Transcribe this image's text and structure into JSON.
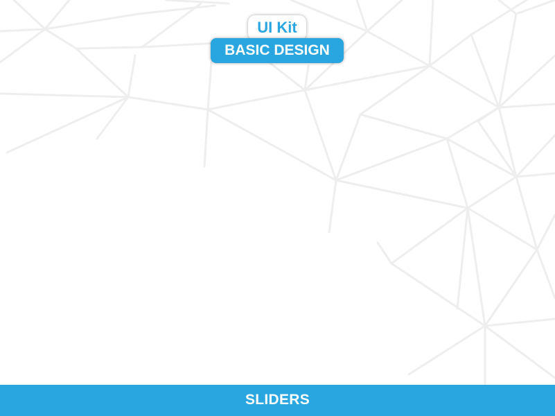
{
  "header": {
    "badge_label": "UI Kit",
    "subtitle_label": "BASIC DESIGN"
  },
  "footer": {
    "section_label": "SLIDERS"
  },
  "colors": {
    "accent": "#29a6e0",
    "background": "#ffffff",
    "pattern_lines": "#eeeeee"
  }
}
